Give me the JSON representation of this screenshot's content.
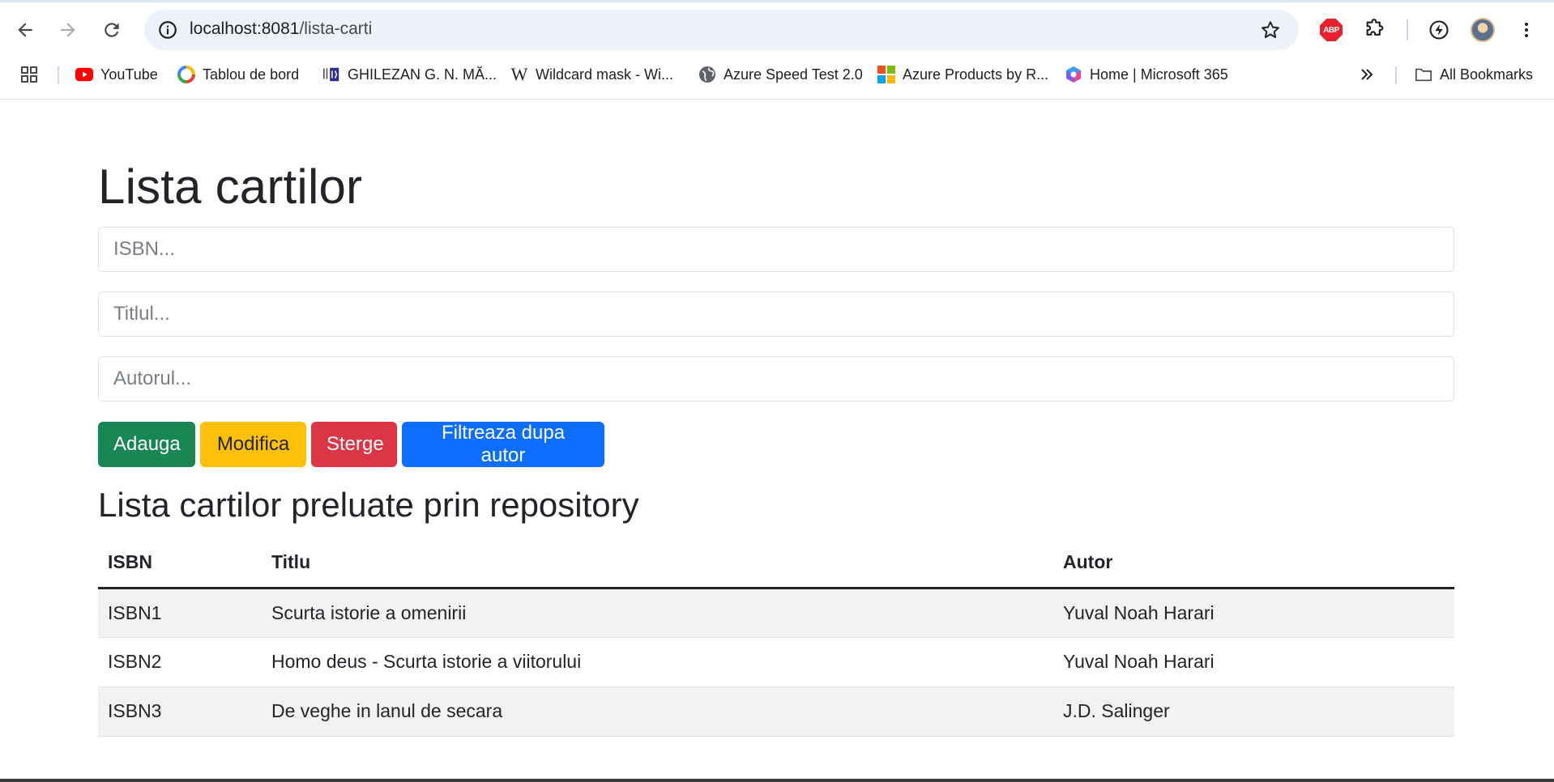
{
  "browser": {
    "url_host": "localhost:8081",
    "url_path": "/lista-carti",
    "bookmarks": [
      {
        "label": "YouTube",
        "icon": "youtube-icon"
      },
      {
        "label": "Tablou de bord",
        "icon": "dashboard-icon"
      },
      {
        "label": "GHILEZAN G. N. MĂ...",
        "icon": "university-icon"
      },
      {
        "label": "Wildcard mask - Wi...",
        "icon": "wikipedia-icon"
      },
      {
        "label": "Azure Speed Test 2.0",
        "icon": "globe-icon"
      },
      {
        "label": "Azure Products by R...",
        "icon": "microsoft-icon"
      },
      {
        "label": "Home | Microsoft 365",
        "icon": "m365-icon"
      }
    ],
    "all_bookmarks_label": "All Bookmarks",
    "abp_label": "ABP"
  },
  "page": {
    "title": "Lista cartilor",
    "inputs": {
      "isbn_placeholder": "ISBN...",
      "title_placeholder": "Titlul...",
      "author_placeholder": "Autorul..."
    },
    "buttons": {
      "add": "Adauga",
      "modify": "Modifica",
      "delete": "Sterge",
      "filter": "Filtreaza dupa autor"
    },
    "subtitle": "Lista cartilor preluate prin repository",
    "table": {
      "headers": [
        "ISBN",
        "Titlu",
        "Autor"
      ],
      "rows": [
        [
          "ISBN1",
          "Scurta istorie a omenirii",
          "Yuval Noah Harari"
        ],
        [
          "ISBN2",
          "Homo deus - Scurta istorie a viitorului",
          "Yuval Noah Harari"
        ],
        [
          "ISBN3",
          "De veghe in lanul de secara",
          "J.D. Salinger"
        ]
      ]
    }
  },
  "colors": {
    "success": "#198754",
    "warning": "#ffc107",
    "danger": "#dc3545",
    "primary": "#0d6efd"
  }
}
